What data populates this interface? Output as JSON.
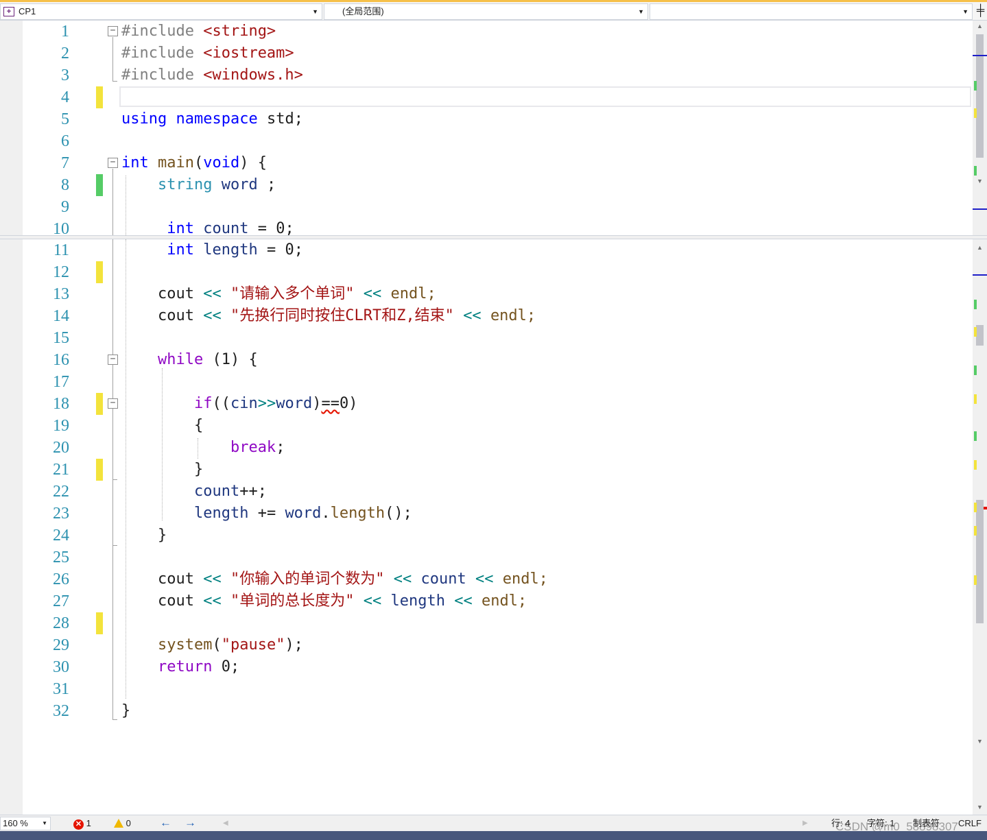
{
  "navbar": {
    "project": "CP1",
    "scope": "(全局范围)",
    "member": "",
    "split_glyph": "⇔"
  },
  "lines": [
    {
      "n": "1"
    },
    {
      "n": "2"
    },
    {
      "n": "3"
    },
    {
      "n": "4"
    },
    {
      "n": "5"
    },
    {
      "n": "6"
    },
    {
      "n": "7"
    },
    {
      "n": "8"
    },
    {
      "n": "9"
    },
    {
      "n": "10"
    },
    {
      "n": "11"
    },
    {
      "n": "12"
    },
    {
      "n": "13"
    },
    {
      "n": "14"
    },
    {
      "n": "15"
    },
    {
      "n": "16"
    },
    {
      "n": "17"
    },
    {
      "n": "18"
    },
    {
      "n": "19"
    },
    {
      "n": "20"
    },
    {
      "n": "21"
    },
    {
      "n": "22"
    },
    {
      "n": "23"
    },
    {
      "n": "24"
    },
    {
      "n": "25"
    },
    {
      "n": "26"
    },
    {
      "n": "27"
    },
    {
      "n": "28"
    },
    {
      "n": "29"
    },
    {
      "n": "30"
    },
    {
      "n": "31"
    },
    {
      "n": "32"
    }
  ],
  "code": {
    "inc1_directive": "#include",
    "inc1_header": "<string>",
    "inc2_directive": "#include",
    "inc2_header": "<iostream>",
    "inc3_directive": "#include",
    "inc3_header": "<windows.h>",
    "using_kw": "using",
    "namespace_kw": "namespace",
    "std": "std;",
    "main_int": "int",
    "main_name": "main",
    "main_paren_open": "(",
    "main_void": "void",
    "main_rest": ") {",
    "string_type": "string",
    "word_var": "word",
    "word_semi": " ;",
    "count_int": "int",
    "count_var": "count",
    "count_rest": " = 0;",
    "length_int": "int",
    "length_var": "length",
    "length_rest": " = 0;",
    "cout1": "cout",
    "cout1_op": "<<",
    "cout1_str": "\"请输入多个单词\"",
    "cout1_op2": "<<",
    "cout1_endl": "endl;",
    "cout2": "cout",
    "cout2_op": "<<",
    "cout2_str": "\"先换行同时按住CLRT和Z,结束\"",
    "cout2_op2": "<<",
    "cout2_endl": "endl;",
    "while_kw": "while",
    "while_rest": " (1) {",
    "if_kw": "if",
    "if_open": "((",
    "if_cin": "cin",
    "if_op": ">>",
    "if_word": "word",
    "if_close": ")",
    "if_eq": "==",
    "if_zero": "0)",
    "brace_open": "{",
    "break_kw": "break",
    "break_semi": ";",
    "brace_close": "}",
    "count_inc": "count",
    "count_inc_rest": "++;",
    "length_upd": "length",
    "length_upd_op": " += ",
    "length_upd_word": "word",
    "length_upd_dot": ".",
    "length_upd_fn": "length",
    "length_upd_rest": "();",
    "while_close": "}",
    "cout3": "cout",
    "cout3_op": "<<",
    "cout3_str": "\"你输入的单词个数为\"",
    "cout3_op2": "<<",
    "cout3_var": "count",
    "cout3_op3": "<<",
    "cout3_endl": "endl;",
    "cout4": "cout",
    "cout4_op": "<<",
    "cout4_str": "\"单词的总长度为\"",
    "cout4_op2": "<<",
    "cout4_var": "length",
    "cout4_op3": "<<",
    "cout4_endl": "endl;",
    "system_fn": "system",
    "system_open": "(",
    "system_str": "\"pause\"",
    "system_close": ");",
    "return_kw": "return",
    "return_rest": " 0;",
    "main_close": "}"
  },
  "fold_toggles": {
    "collapse": "−"
  },
  "status": {
    "zoom": "160 %",
    "errors": "1",
    "warnings": "0",
    "back_arrow": "←",
    "forward_arrow": "→",
    "line": "行: 4",
    "char": "字符: 1",
    "tabs": "制表符",
    "eol": "CRLF",
    "watermark": "CSDN @m0_58898307"
  },
  "colors": {
    "keyword": "#0000ff",
    "type": "#2b91af",
    "control": "#8f08c4",
    "string": "#a31515",
    "identifier": "#1f377f",
    "function": "#74531f",
    "line_number": "#2b91af",
    "change_unsaved": "#f3e33c",
    "change_saved": "#55cc66"
  },
  "icons": {
    "project": "cpp-project-icon",
    "error": "error-icon",
    "warning": "warning-icon",
    "fold": "collapse-icon"
  }
}
